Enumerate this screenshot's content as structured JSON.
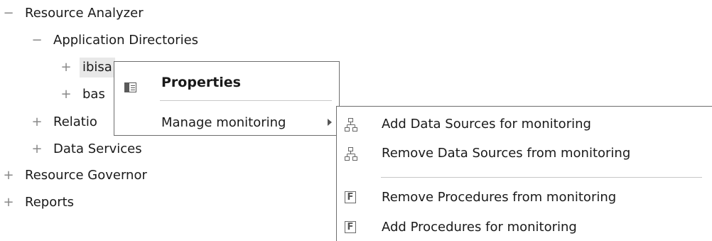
{
  "tree": {
    "resource_analyzer": {
      "toggle": "−",
      "label": "Resource Analyzer"
    },
    "application_directories": {
      "toggle": "−",
      "label": "Application Directories"
    },
    "ibisamp": {
      "toggle": "+",
      "label": "ibisa"
    },
    "base": {
      "toggle": "+",
      "label": "bas"
    },
    "relational": {
      "toggle": "+",
      "label": "Relatio"
    },
    "data_services": {
      "toggle": "+",
      "label": "Data Services"
    },
    "resource_governor": {
      "toggle": "+",
      "label": "Resource Governor"
    },
    "reports": {
      "toggle": "+",
      "label": "Reports"
    }
  },
  "context_menu": {
    "properties_label": "Properties",
    "manage_monitoring_label": "Manage monitoring"
  },
  "submenu": {
    "items": [
      {
        "label": "Add Data Sources for monitoring",
        "icon": "data-source-icon"
      },
      {
        "label": "Remove Data Sources from monitoring",
        "icon": "data-source-icon"
      },
      {
        "label": "Remove Procedures from monitoring",
        "icon": "procedure-f-icon",
        "icon_text": "F"
      },
      {
        "label": "Add Procedures for monitoring",
        "icon": "procedure-f-icon",
        "icon_text": "F"
      }
    ]
  },
  "colors": {
    "toggle": "#888888",
    "menu_border": "#6e6e6e",
    "separator": "#c8c8c8",
    "selected_bg": "#e8e8e8"
  }
}
